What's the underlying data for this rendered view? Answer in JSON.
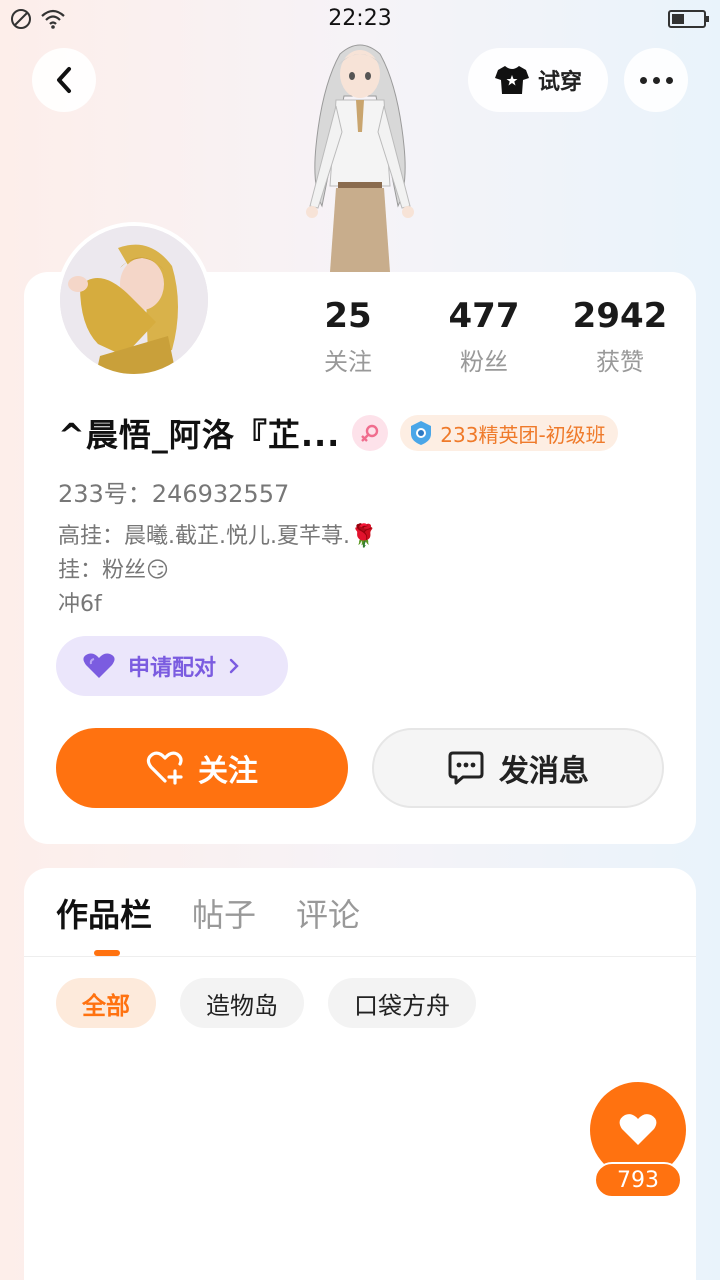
{
  "status_bar": {
    "time": "22:23"
  },
  "header": {
    "tryon_label": "试穿"
  },
  "profile": {
    "stats": [
      {
        "num": "25",
        "label": "关注"
      },
      {
        "num": "477",
        "label": "粉丝"
      },
      {
        "num": "2942",
        "label": "获赞"
      }
    ],
    "name": "^晨悟_阿洛『芷...",
    "rank_badge": "233精英团-初级班",
    "uid": "233号：246932557",
    "bio_lines": [
      "高挂：晨曦.截芷.悦儿.夏芊荨.🌹",
      "挂：粉丝😏",
      "冲6f"
    ],
    "pair_label": "申请配对",
    "follow_label": "关注",
    "message_label": "发消息"
  },
  "content": {
    "tabs": [
      "作品栏",
      "帖子",
      "评论"
    ],
    "filters": [
      "全部",
      "造物岛",
      "口袋方舟"
    ]
  },
  "like": {
    "count": "793"
  },
  "colors": {
    "accent": "#ff7210",
    "pair": "#7b5ce0",
    "badge": "#ef7a2a"
  }
}
